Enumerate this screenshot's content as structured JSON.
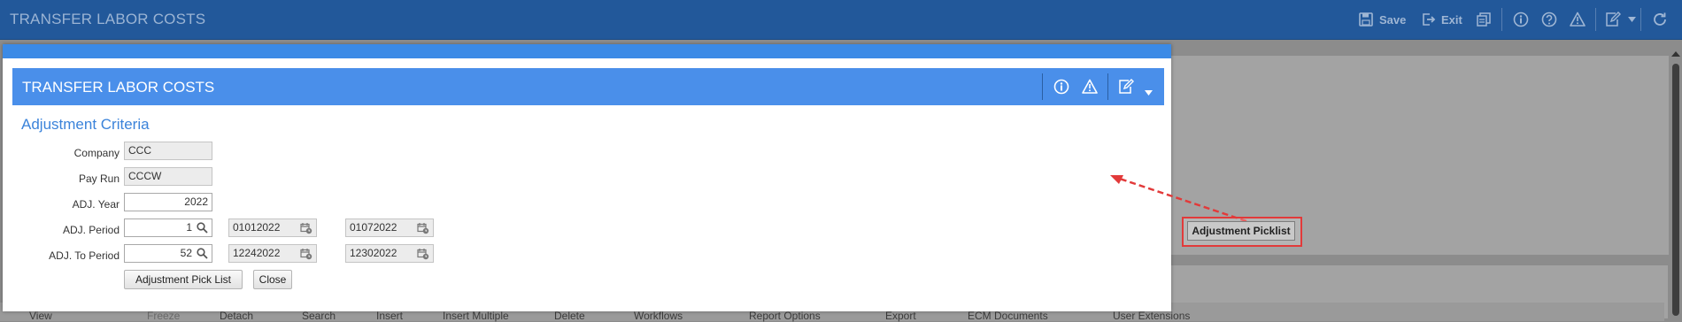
{
  "app": {
    "title": "TRANSFER LABOR COSTS",
    "toolbar": {
      "save_label": "Save",
      "exit_label": "Exit"
    }
  },
  "background": {
    "adjustment_picklist_button": "Adjustment Picklist",
    "toolbar": {
      "view": "View",
      "freeze": "Freeze",
      "detach": "Detach",
      "search": "Search",
      "insert": "Insert",
      "insert_multiple": "Insert Multiple",
      "delete": "Delete",
      "workflows": "Workflows",
      "report_options": "Report Options",
      "export": "Export",
      "ecm_documents": "ECM Documents",
      "user_extensions": "User Extensions"
    }
  },
  "dialog": {
    "title": "TRANSFER LABOR COSTS",
    "section_title": "Adjustment Criteria",
    "fields": {
      "company": {
        "label": "Company",
        "value": "CCC"
      },
      "pay_run": {
        "label": "Pay Run",
        "value": "CCCW"
      },
      "adj_year": {
        "label": "ADJ. Year",
        "value": "2022"
      },
      "adj_period": {
        "label": "ADJ. Period",
        "value": "1",
        "start_date": "01012022",
        "end_date": "01072022"
      },
      "adj_to_period": {
        "label": "ADJ. To Period",
        "value": "52",
        "start_date": "12242022",
        "end_date": "12302022"
      }
    },
    "buttons": {
      "adjustment_pick_list": "Adjustment Pick List",
      "close": "Close"
    }
  },
  "colors": {
    "topbar": "#22589a",
    "dialog_header": "#4a8fea",
    "section_title": "#3b83da",
    "highlight": "#e23a3a"
  }
}
